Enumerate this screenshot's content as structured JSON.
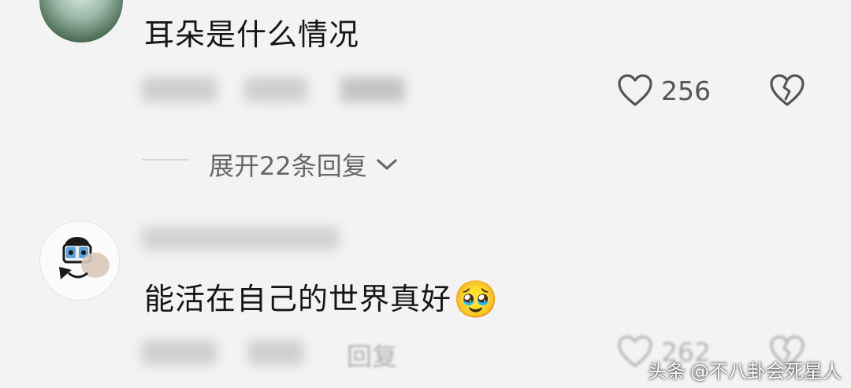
{
  "comments": [
    {
      "text": "耳朵是什么情况",
      "likes": "256"
    },
    {
      "text": "能活在自己的世界真好",
      "emoji": "🥹",
      "reply_label": "回复",
      "likes": "262"
    }
  ],
  "expand_replies": {
    "label": "展开22条回复"
  },
  "watermark": {
    "platform": "头条",
    "account": "@不八卦会死星人"
  },
  "icons": {
    "like": "heart-outline-icon",
    "dislike": "broken-heart-icon",
    "expand": "chevron-down-icon"
  },
  "colors": {
    "background": "#f3f3f3",
    "text": "#161616",
    "muted": "#666666"
  }
}
